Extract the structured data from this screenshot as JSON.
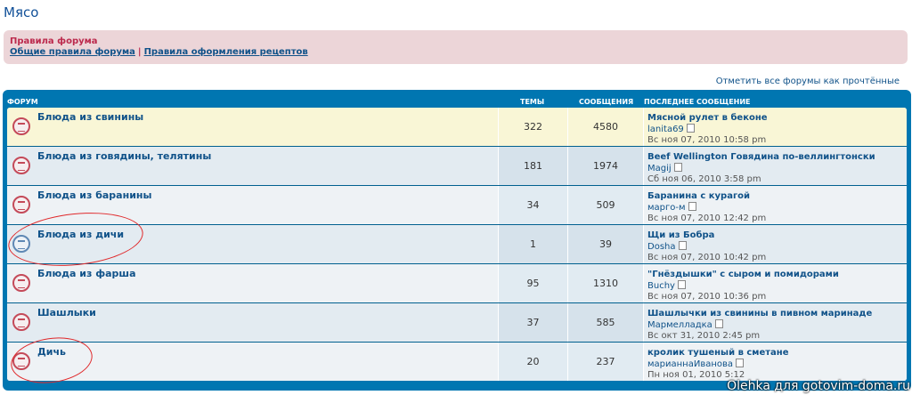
{
  "page": {
    "title": "Мясо"
  },
  "rules": {
    "title": "Правила форума",
    "link1": "Общие правила форума",
    "separator": "|",
    "link2": "Правила оформления рецептов"
  },
  "mark_read": "Отметить все форумы как прочтённые",
  "table": {
    "headers": {
      "forum": "ФОРУМ",
      "topics": "ТЕМЫ",
      "posts": "СООБЩЕНИЯ",
      "last": "ПОСЛЕДНЕЕ СООБЩЕНИЕ"
    },
    "rows": [
      {
        "name": "Блюда из свинины",
        "topics": "322",
        "posts": "4580",
        "last_title": "Мясной рулет в беконе",
        "last_author": "lanita69",
        "last_date": "Вс ноя 07, 2010 10:58 pm",
        "icon": "forum-read-icon"
      },
      {
        "name": "Блюда из говядины, телятины",
        "topics": "181",
        "posts": "1974",
        "last_title": "Beef Wellington Говядина по-веллингтонски",
        "last_author": "Magij",
        "last_date": "Сб ноя 06, 2010 3:58 pm",
        "icon": "forum-read-icon"
      },
      {
        "name": "Блюда из баранины",
        "topics": "34",
        "posts": "509",
        "last_title": "Баранина с курагой",
        "last_author": "марго-м",
        "last_date": "Вс ноя 07, 2010 12:42 pm",
        "icon": "forum-read-icon"
      },
      {
        "name": "Блюда из дичи",
        "topics": "1",
        "posts": "39",
        "last_title": "Щи из Бобра",
        "last_author": "Dosha",
        "last_date": "Вс ноя 07, 2010 10:42 pm",
        "icon": "forum-unread-icon"
      },
      {
        "name": "Блюда из фарша",
        "topics": "95",
        "posts": "1310",
        "last_title": "\"Гнёздышки\" с сыром и помидорами",
        "last_author": "Buchy",
        "last_date": "Вс ноя 07, 2010 10:36 pm",
        "icon": "forum-read-icon"
      },
      {
        "name": "Шашлыки",
        "topics": "37",
        "posts": "585",
        "last_title": "Шашлычки из свинины в пивном маринаде",
        "last_author": "Мармелладка",
        "last_date": "Вс окт 31, 2010 2:45 pm",
        "icon": "forum-read-icon"
      },
      {
        "name": "Дичь",
        "topics": "20",
        "posts": "237",
        "last_title": "кролик тушеный в сметане",
        "last_author": "марианнаИванова",
        "last_date": "Пн ноя 01, 2010 5:12",
        "icon": "forum-read-icon"
      }
    ]
  },
  "watermark": "Olehka для gotovim-doma.ru"
}
